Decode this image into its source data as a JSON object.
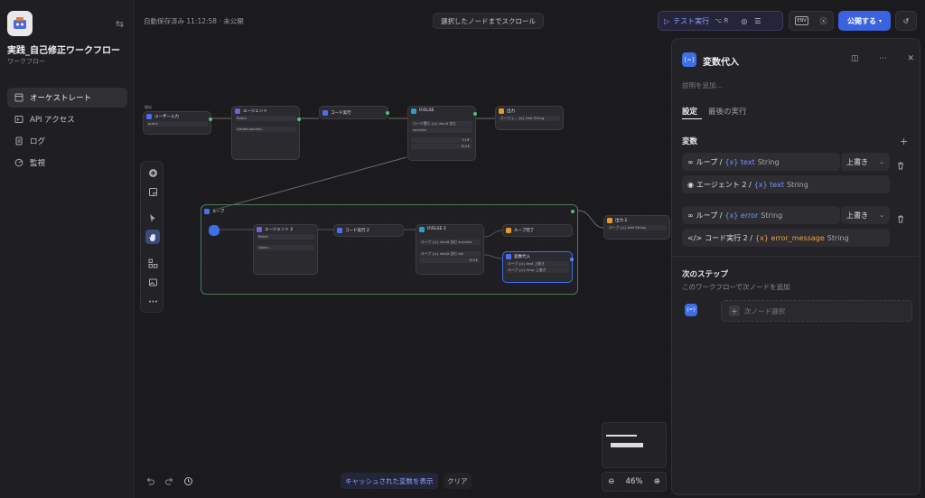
{
  "sidebar": {
    "app_title": "実践_自己修正ワークフロー",
    "app_subtitle": "ワークフロー",
    "items": [
      {
        "label": "オーケストレート",
        "icon": "layout-icon",
        "active": true
      },
      {
        "label": "API アクセス",
        "icon": "terminal-icon",
        "active": false
      },
      {
        "label": "ログ",
        "icon": "document-icon",
        "active": false
      },
      {
        "label": "監視",
        "icon": "monitor-icon",
        "active": false
      }
    ]
  },
  "topbar": {
    "autosave": "自動保存済み 11:12:58 · 未公開",
    "scroll_to_node": "選択したノードまでスクロール",
    "run_label": "テスト実行",
    "run_shortcut": "⌥ R",
    "env_label": "ENV",
    "publish_label": "公開する"
  },
  "nodes": {
    "start_caption": "開始",
    "user_input": "ユーザー入力",
    "user_input_row": "query",
    "agent": "エージェント",
    "agent_strategy": "ReAct",
    "agent_model": "claude-sonnet...",
    "code_exec": "コード実行",
    "ifelse": "IF/ELSE",
    "ifelse_rows": [
      "CASE 1",
      "コード実行 {x} result 含む",
      "success",
      "CASE 2",
      "ELIF",
      "ELSE"
    ],
    "output": "出力",
    "output_row": "エージェ... {x} text String",
    "loop": "ループ",
    "agent2": "エージェント 2",
    "agent2_strategy": "ReAct",
    "agent2_model": "Qwen...",
    "code_exec2": "コード実行 2",
    "ifelse2": "IF/ELSE 2",
    "ifelse2_rows": [
      "CASE 1",
      "ループ {x} result 含む success",
      "CASE 2",
      "ELIF",
      "ループ {x} result 含む fail",
      "ELSE"
    ],
    "loop_end": "ループ完了",
    "assign": "変数代入",
    "assign_rows": [
      "ループ {x} text 上書き",
      "ループ {x} error 上書き"
    ],
    "output2": "出力 2",
    "output2_row": "ループ {x} text String"
  },
  "bottom": {
    "cache_label": "キャッシュされた変数を表示",
    "clear_label": "クリア",
    "zoom": "46%"
  },
  "panel": {
    "title": "変数代入",
    "icon_text": "{=}",
    "description_placeholder": "説明を追加...",
    "tabs": [
      "設定",
      "最後の実行"
    ],
    "section": "変数",
    "variables": [
      {
        "target_prefix": "ループ /",
        "target_var": "{x} text",
        "target_type": "String",
        "mode": "上書き",
        "source_prefix": "エージェント 2 /",
        "source_var": "{x} text",
        "source_type": "String",
        "source_color": "blue"
      },
      {
        "target_prefix": "ループ /",
        "target_var": "{x} error",
        "target_type": "String",
        "mode": "上書き",
        "source_prefix": "コード実行 2 /",
        "source_var": "{x} error_message",
        "source_type": "String",
        "source_color": "orange"
      }
    ],
    "next_title": "次のステップ",
    "next_sub": "このワークフローで次ノードを追加",
    "next_select": "次ノード選択"
  },
  "colors": {
    "accent": "#3a63e0",
    "variable_blue": "#7b95ff",
    "variable_orange": "#f0a040"
  }
}
